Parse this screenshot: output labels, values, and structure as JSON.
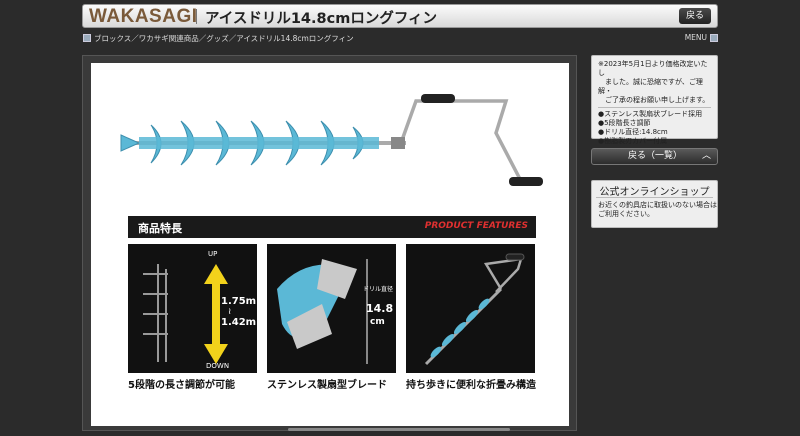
{
  "header": {
    "logo": "WAKASAGI",
    "title": "アイスドリル14.8cmロングフィン",
    "back_label": "戻る"
  },
  "breadcrumb": {
    "text": "ブロックス／ワカサギ関連商品／グッズ／アイスドリル14.8cmロングフィン",
    "menu_label": "MENU"
  },
  "product": {
    "banner_left": "商品特長",
    "banner_right": "PRODUCT FEATURES",
    "features": [
      {
        "caption": "5段階の長さ調節が可能",
        "up": "UP",
        "down": "DOWN",
        "len_max": "1.75m",
        "len_sep": "≀",
        "len_min": "1.42m"
      },
      {
        "caption": "ステンレス製扇型ブレード",
        "diam_label": "ドリル直径",
        "diam_value": "14.8",
        "diam_unit": "cm"
      },
      {
        "caption": "持ち歩きに便利な折畳み構造"
      }
    ]
  },
  "sidebar": {
    "notice_lines": [
      "※2023年5月1日より価格改定いたし",
      "　ました。誠に恐縮ですが、ご理解・",
      "　ご了承の程お願い申し上げます。"
    ],
    "specs": [
      "●ステンレス製扇状ブレード採用",
      "●5段階長さ調節",
      "●ドリル直径:14.8cm",
      "●樹脂製刃カバー付属"
    ],
    "back_list_label": "戻る（一覧）",
    "shop_title": "公式オンラインショップ",
    "shop_desc_lines": [
      "お近くの釣具店に取扱いのない場合は",
      "ご利用ください。"
    ]
  },
  "colors": {
    "accent_blue": "#5bb8d6",
    "logo_brown": "#7a5a3a",
    "banner_red": "#e03030"
  }
}
